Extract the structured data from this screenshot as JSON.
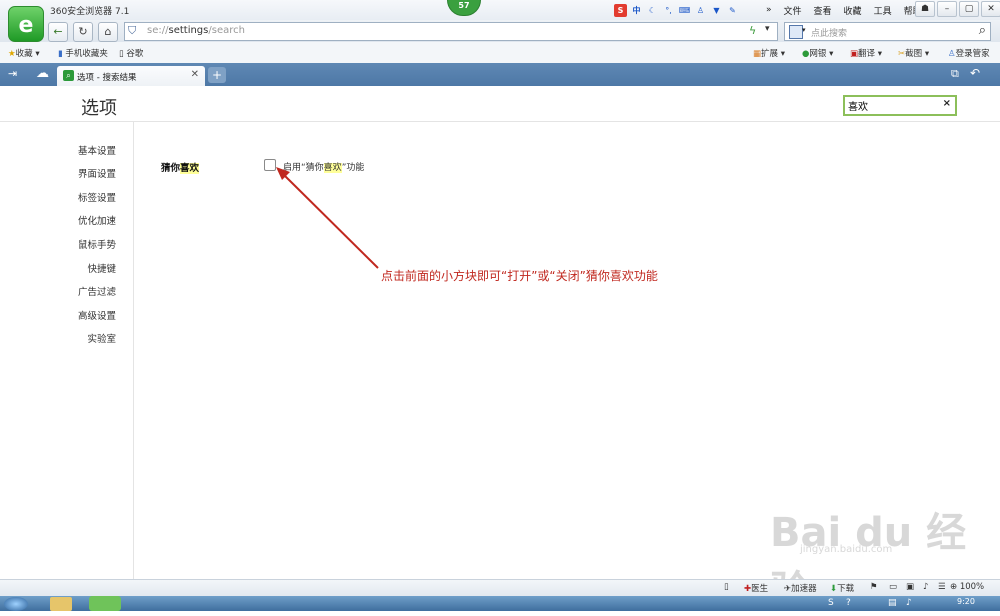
{
  "window": {
    "title": "360安全浏览器 7.1",
    "badge_count": "57",
    "menu": [
      "文件",
      "查看",
      "收藏",
      "工具",
      "帮助"
    ]
  },
  "ime": {
    "s_label": "S",
    "zh_label": "中"
  },
  "address": {
    "scheme": "se://",
    "path": "settings",
    "suffix": "/search"
  },
  "search": {
    "placeholder": "点此搜索"
  },
  "bookmarks": {
    "favorites": "收藏",
    "mobile": "手机收藏夹",
    "google": "谷歌"
  },
  "tools": {
    "extensions": "扩展",
    "netbank": "网银",
    "translate": "翻译",
    "screenshot": "截图",
    "login": "登录管家"
  },
  "tab": {
    "label": "选项 - 搜索结果"
  },
  "page": {
    "title": "选项",
    "find_value": "喜欢"
  },
  "sidebar": {
    "items": [
      {
        "label": "基本设置"
      },
      {
        "label": "界面设置"
      },
      {
        "label": "标签设置"
      },
      {
        "label": "优化加速"
      },
      {
        "label": "鼠标手势"
      },
      {
        "label": "快捷键"
      },
      {
        "label": "广告过滤"
      },
      {
        "label": "高级设置"
      },
      {
        "label": "实验室"
      }
    ]
  },
  "section": {
    "label_pre": "猜你",
    "label_hl": "喜欢",
    "checkbox_pre": "启用“猜你",
    "checkbox_hl": "喜欢",
    "checkbox_post": "”功能",
    "checked": false
  },
  "annotation": "点击前面的小方块即可“打开”或“关闭”猜你喜欢功能",
  "watermark": {
    "main": "Bai du 经验",
    "sub": "jingyan.baidu.com"
  },
  "statusbar": {
    "doctor": "医生",
    "accelerator": "加速器",
    "download": "下载",
    "zoom": "100%"
  },
  "taskbar": {
    "time": "9:20"
  },
  "colors": {
    "accent_green": "#2c9a3a",
    "tab_bar": "#5f88b4",
    "annotation_red": "#c0281f",
    "highlight": "#ffff99"
  }
}
